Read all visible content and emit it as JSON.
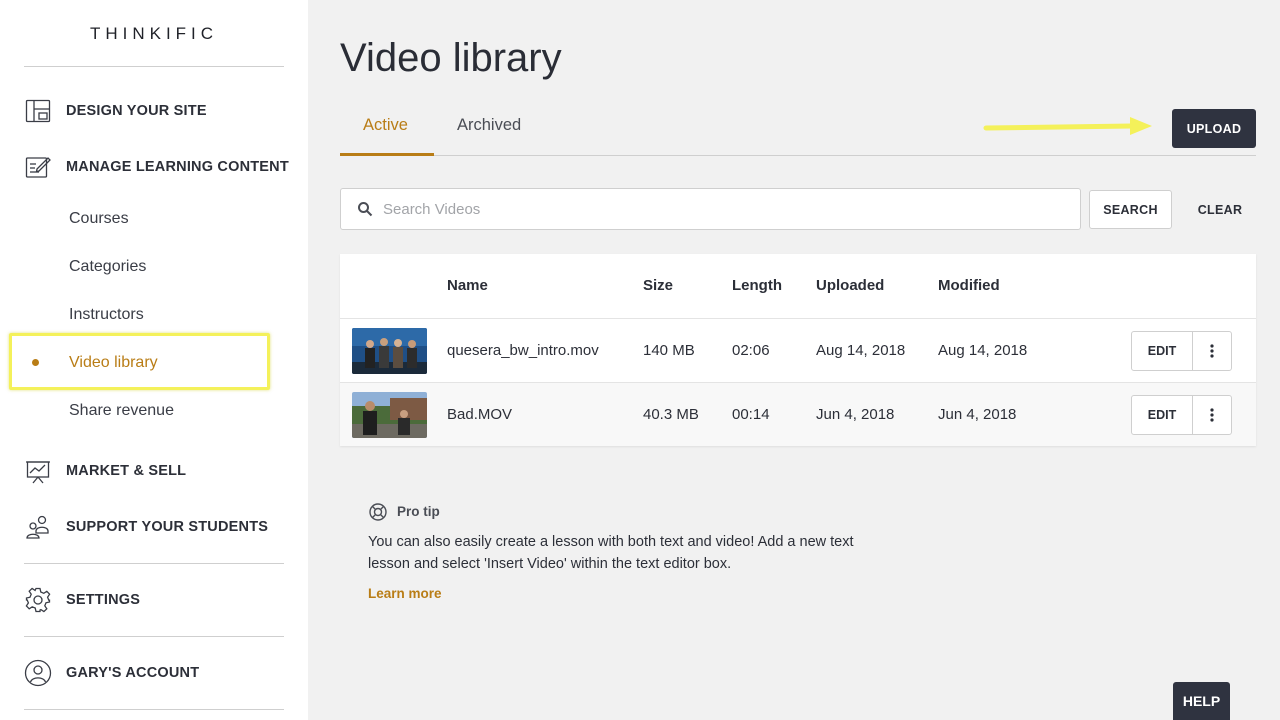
{
  "brand": {
    "logo_text": "THINKIFIC"
  },
  "sidebar": {
    "main_items": [
      {
        "label": "DESIGN YOUR SITE",
        "icon": "layout-icon"
      },
      {
        "label": "MANAGE LEARNING CONTENT",
        "icon": "edit-content-icon"
      },
      {
        "label": "MARKET & SELL",
        "icon": "chart-board-icon"
      },
      {
        "label": "SUPPORT YOUR STUDENTS",
        "icon": "students-icon"
      },
      {
        "label": "SETTINGS",
        "icon": "gear-icon"
      },
      {
        "label": "GARY'S ACCOUNT",
        "icon": "user-circle-icon"
      }
    ],
    "sub_items": [
      {
        "label": "Courses"
      },
      {
        "label": "Categories"
      },
      {
        "label": "Instructors"
      },
      {
        "label": "Video library",
        "active": true
      },
      {
        "label": "Share revenue"
      }
    ]
  },
  "main": {
    "title": "Video library",
    "tabs": [
      {
        "label": "Active",
        "active": true
      },
      {
        "label": "Archived"
      }
    ],
    "upload_label": "UPLOAD",
    "search": {
      "placeholder": "Search Videos",
      "value": "",
      "button_label": "SEARCH",
      "clear_label": "CLEAR"
    },
    "table": {
      "columns": [
        "Name",
        "Size",
        "Length",
        "Uploaded",
        "Modified"
      ],
      "rows": [
        {
          "name": "quesera_bw_intro.mov",
          "size": "140 MB",
          "length": "02:06",
          "uploaded": "Aug 14, 2018",
          "modified": "Aug 14, 2018",
          "edit_label": "EDIT"
        },
        {
          "name": "Bad.MOV",
          "size": "40.3 MB",
          "length": "00:14",
          "uploaded": "Jun 4, 2018",
          "modified": "Jun 4, 2018",
          "edit_label": "EDIT"
        }
      ]
    },
    "pro_tip": {
      "title": "Pro tip",
      "body": "You can also easily create a lesson with both text and video! Add a new text lesson and select 'Insert Video' within the text editor box.",
      "link_label": "Learn more"
    }
  },
  "help_label": "HELP",
  "colors": {
    "accent": "#b97d16",
    "dark_button": "#2f3340",
    "annotation_highlight": "#f4f15a"
  }
}
